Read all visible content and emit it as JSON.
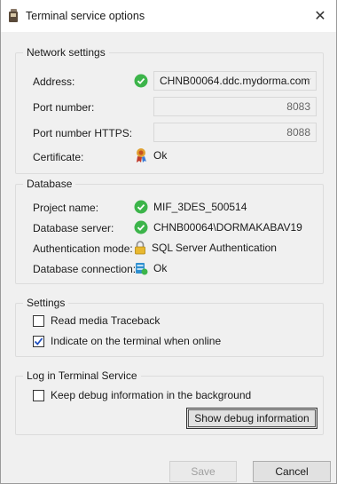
{
  "window": {
    "title": "Terminal service options",
    "close_glyph": "✕"
  },
  "network": {
    "legend": "Network settings",
    "address_label": "Address:",
    "address_value": "CHNB00064.ddc.mydorma.com",
    "port_label": "Port number:",
    "port_value": "8083",
    "port_https_label": "Port number HTTPS:",
    "port_https_value": "8088",
    "certificate_label": "Certificate:",
    "certificate_value": "Ok"
  },
  "database": {
    "legend": "Database",
    "project_label": "Project name:",
    "project_value": "MIF_3DES_500514",
    "server_label": "Database server:",
    "server_value": "CHNB00064\\DORMAKABAV19",
    "auth_label": "Authentication mode:",
    "auth_value": "SQL Server Authentication",
    "connection_label": "Database connection:",
    "connection_value": "Ok"
  },
  "settings": {
    "legend": "Settings",
    "read_media_label": "Read media Traceback",
    "read_media_checked": false,
    "indicate_label": "Indicate on the terminal when online",
    "indicate_checked": true
  },
  "log": {
    "legend": "Log in Terminal Service",
    "keep_debug_label": "Keep debug information in the background",
    "keep_debug_checked": false,
    "show_debug_button": "Show debug information"
  },
  "footer": {
    "save_label": "Save",
    "cancel_label": "Cancel"
  },
  "colors": {
    "ok_green": "#3cb44a",
    "window_bg": "#f0f0f0",
    "title_bg": "#ffffff"
  }
}
